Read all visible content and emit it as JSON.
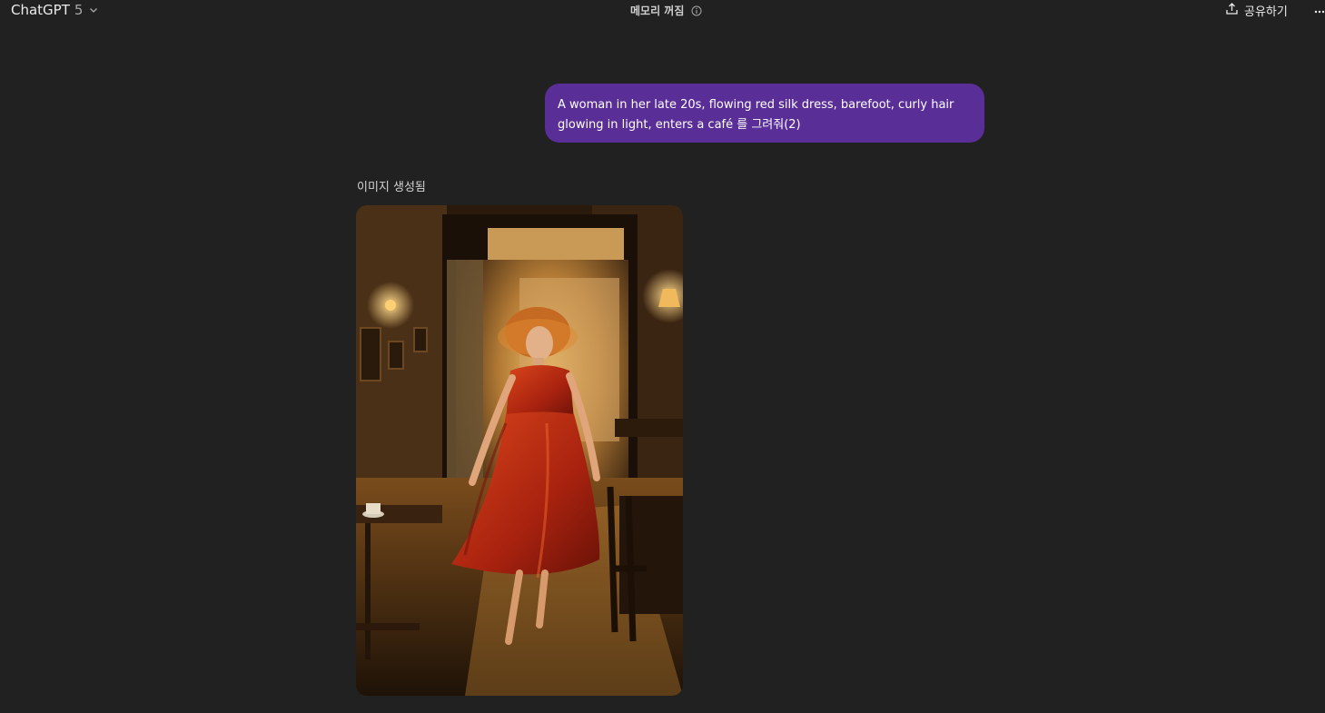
{
  "header": {
    "model_name": "ChatGPT",
    "model_version": "5",
    "memory_status": "메모리 꺼짐",
    "share_label": "공유하기"
  },
  "conversation": {
    "user_message": "A woman in her late 20s, flowing red silk dress, barefoot, curly hair glowing in light, enters a café 를 그려줘(2)",
    "assistant": {
      "status_label": "이미지 생성됨"
    }
  },
  "icons": {
    "model_dropdown": "chevron-down-icon",
    "memory_info": "info-icon",
    "share": "upload-icon",
    "more": "ellipsis-icon"
  },
  "colors": {
    "background": "#212121",
    "user_bubble": "#5a2e97"
  }
}
